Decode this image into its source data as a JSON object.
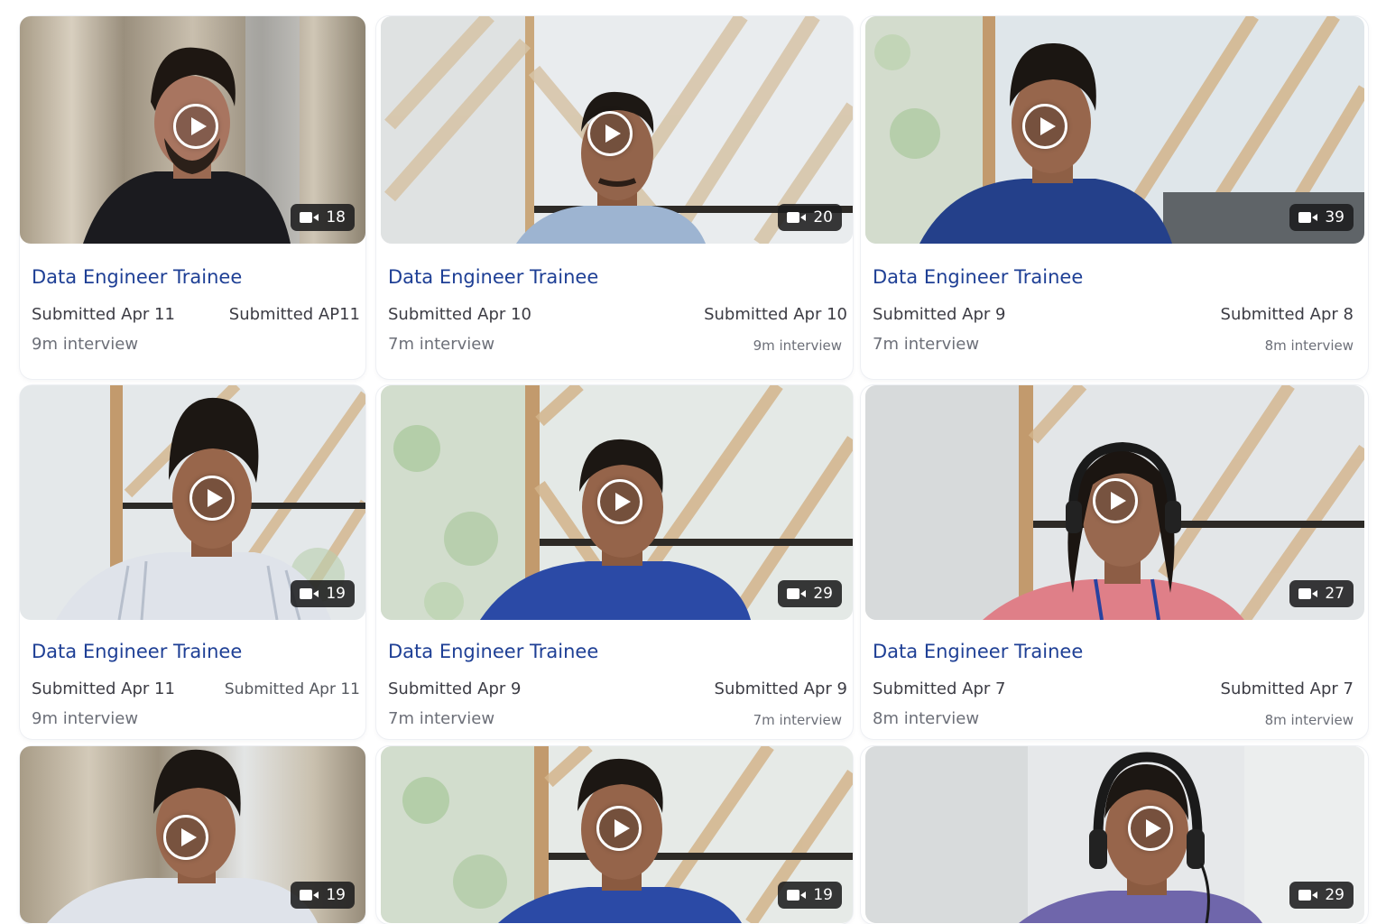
{
  "cards": [
    {
      "title": "Data Engineer Trainee",
      "submitted_left": "Submitted Apr 11",
      "submitted_right": "Submitted AP11",
      "duration_left": "9m interview",
      "duration_right": "",
      "clip_count": "18",
      "camera_icon": "video-camera-icon",
      "play_icon": "play-icon"
    },
    {
      "title": "Data Engineer Trainee",
      "submitted_left": "Submitted Apr 10",
      "submitted_right": "Submitted Apr 10",
      "duration_left": "7m interview",
      "duration_right": "9m interview",
      "clip_count": "20",
      "camera_icon": "video-camera-icon",
      "play_icon": "play-icon"
    },
    {
      "title": "Data Engineer Trainee",
      "submitted_left": "Submitted Apr 9",
      "submitted_right": "Submitted Apr 8",
      "duration_left": "7m interview",
      "duration_right": "8m interview",
      "clip_count": "39",
      "camera_icon": "video-camera-icon",
      "play_icon": "play-icon"
    },
    {
      "title": "Data Engineer Trainee",
      "submitted_left": "Submitted Apr 11",
      "submitted_right": "Submitted Apr 11",
      "duration_left": "9m interview",
      "duration_right": "",
      "clip_count": "19",
      "camera_icon": "video-camera-icon",
      "play_icon": "play-icon"
    },
    {
      "title": "Data Engineer Trainee",
      "submitted_left": "Submitted Apr 9",
      "submitted_right": "Submitted Apr 9",
      "duration_left": "7m interview",
      "duration_right": "7m interview",
      "clip_count": "29",
      "camera_icon": "video-camera-icon",
      "play_icon": "play-icon"
    },
    {
      "title": "Data Engineer Trainee",
      "submitted_left": "Submitted Apr 7",
      "submitted_right": "Submitted Apr 7",
      "duration_left": "8m interview",
      "duration_right": "8m interview",
      "clip_count": "27",
      "camera_icon": "video-camera-icon",
      "play_icon": "play-icon"
    },
    {
      "title": "",
      "submitted_left": "",
      "submitted_right": "",
      "duration_left": "",
      "duration_right": "",
      "clip_count": "19",
      "camera_icon": "video-camera-icon",
      "play_icon": "play-icon"
    },
    {
      "title": "",
      "submitted_left": "",
      "submitted_right": "",
      "duration_left": "",
      "duration_right": "",
      "clip_count": "19",
      "camera_icon": "video-camera-icon",
      "play_icon": "play-icon"
    },
    {
      "title": "",
      "submitted_left": "",
      "submitted_right": "",
      "duration_left": "",
      "duration_right": "",
      "clip_count": "29",
      "camera_icon": "video-camera-icon",
      "play_icon": "play-icon"
    }
  ],
  "colors": {
    "title": "#1e3f95",
    "text": "#3c3c44",
    "muted": "#6c6f78",
    "badge_bg": "#1c1c1e",
    "shirt_black": "#1b1b1f",
    "shirt_light": "#dfe3ea",
    "shirt_blue": "#24408a",
    "shirt_pink": "#d9727d",
    "shirt_purple": "#6f66ab"
  }
}
